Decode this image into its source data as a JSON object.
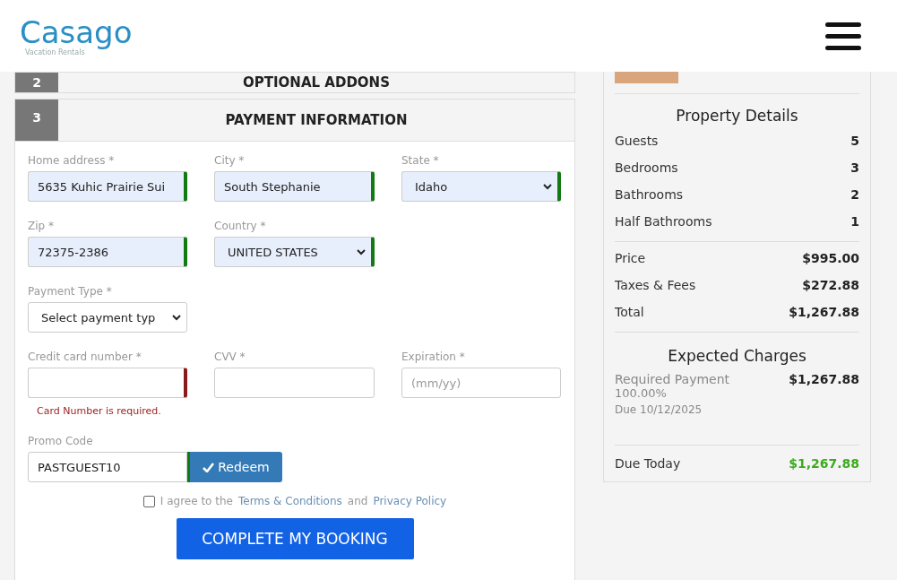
{
  "header": {
    "logo": {
      "name": "Casago",
      "tagline": "Vacation Rentals"
    }
  },
  "steps": [
    {
      "number": "2",
      "title": "OPTIONAL ADDONS",
      "expanded": false
    },
    {
      "number": "3",
      "title": "PAYMENT INFORMATION",
      "expanded": true
    }
  ],
  "form": {
    "rows": [
      [
        {
          "kind": "input",
          "label": "Home address *",
          "value": "5635 Kuhic Prairie Sui",
          "valid": true
        },
        {
          "kind": "input",
          "label": "City *",
          "value": "South Stephanie",
          "valid": true
        },
        {
          "kind": "select",
          "label": "State *",
          "value": "Idaho",
          "valid": true
        }
      ],
      [
        {
          "kind": "input",
          "label": "Zip *",
          "value": "72375-2386",
          "valid": true
        },
        {
          "kind": "select",
          "label": "Country *",
          "value": "UNITED STATES",
          "valid": true
        }
      ],
      [
        {
          "kind": "select",
          "label": "Payment Type *",
          "value": "Select payment typ",
          "valid": false
        }
      ],
      [
        {
          "kind": "input",
          "label": "Credit card number *",
          "valid": false,
          "invalid": true,
          "error": "Card Number is required."
        },
        {
          "kind": "input",
          "label": "CVV *",
          "valid": false
        },
        {
          "kind": "input",
          "label": "Expiration *",
          "placeholder": "(mm/yy)",
          "valid": false
        }
      ]
    ],
    "promo": {
      "label": "Promo Code",
      "value": "PASTGUEST10",
      "button": "Redeem"
    },
    "agree": {
      "checked": false,
      "before": "I agree to the",
      "terms": "Terms & Conditions",
      "middle": "and",
      "privacy": "Privacy Policy"
    },
    "submit": "COMPLETE MY BOOKING"
  },
  "summary": {
    "property_title": "Property Details",
    "details": [
      {
        "label": "Guests",
        "value": "5"
      },
      {
        "label": "Bedrooms",
        "value": "3"
      },
      {
        "label": "Bathrooms",
        "value": "2"
      },
      {
        "label": "Half Bathrooms",
        "value": "1"
      }
    ],
    "prices": [
      {
        "label": "Price",
        "value": "$995.00"
      },
      {
        "label": "Taxes & Fees",
        "value": "$272.88"
      },
      {
        "label": "Total",
        "value": "$1,267.88"
      }
    ],
    "charges_title": "Expected Charges",
    "charge": {
      "label": "Required Payment",
      "percent": "100.00%",
      "due": "Due 10/12/2025",
      "value": "$1,267.88"
    },
    "due_today": {
      "label": "Due Today",
      "value": "$1,267.88"
    }
  }
}
